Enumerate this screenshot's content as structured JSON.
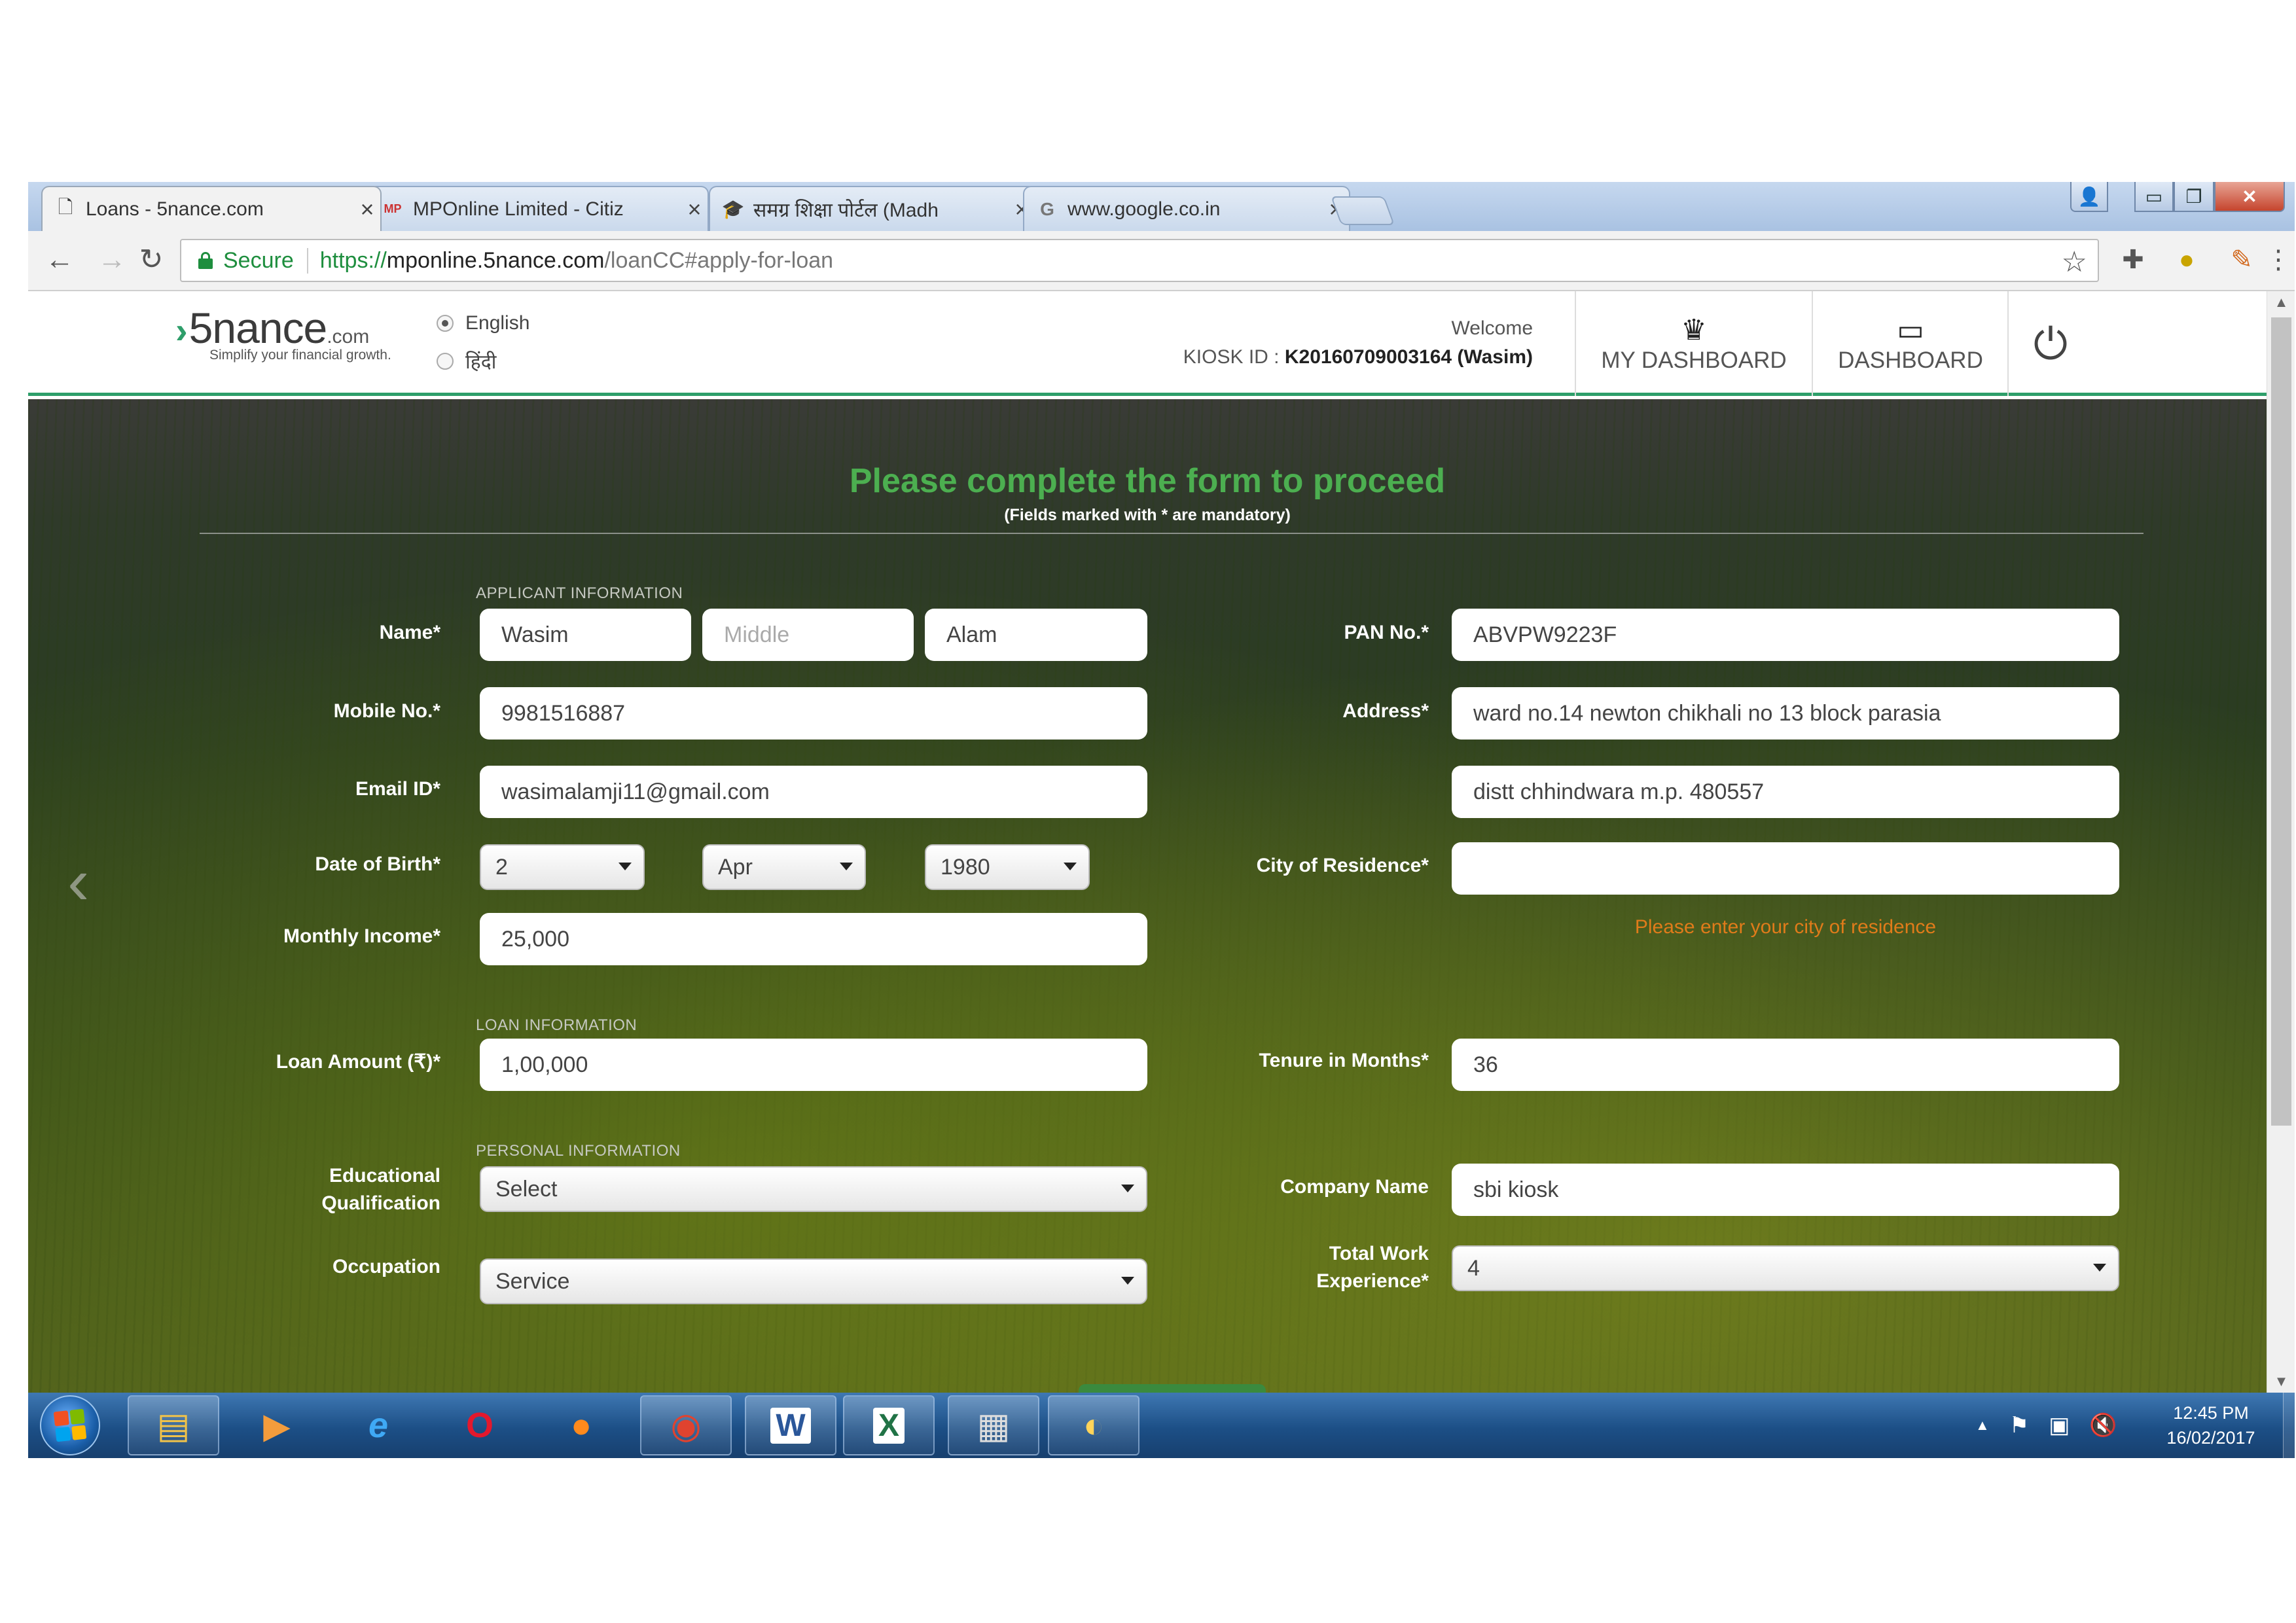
{
  "browser": {
    "tabs": [
      {
        "label": "Loans - 5nance.com",
        "icon": "page-icon",
        "close": "×"
      },
      {
        "label": "MPOnline Limited - Citiz",
        "icon": "mponline-icon",
        "close": "×"
      },
      {
        "label": "समग्र शिक्षा पोर्टल (Madh",
        "icon": "graduation-cap-icon",
        "close": "×"
      },
      {
        "label": "www.google.co.in",
        "icon": "google-icon",
        "close": "×"
      }
    ],
    "secure_label": "Secure",
    "url_scheme": "https://",
    "url_host": "mponline.5nance.com",
    "url_path": "/loanCC#apply-for-loan"
  },
  "site": {
    "logo_name": "5nance",
    "logo_com": ".com",
    "logo_tagline": "Simplify your financial growth.",
    "languages": [
      "English",
      "हिंदी"
    ],
    "selected_language": "English",
    "welcome": "Welcome",
    "kiosk_label": "KIOSK ID : ",
    "kiosk_value": "K20160709003164 (Wasim)",
    "nav": [
      "MY DASHBOARD",
      "DASHBOARD"
    ]
  },
  "form": {
    "title": "Please complete the form to proceed",
    "subtitle": "(Fields marked with * are mandatory)",
    "sections": {
      "applicant": "APPLICANT INFORMATION",
      "loan": "LOAN INFORMATION",
      "personal": "PERSONAL INFORMATION"
    },
    "labels": {
      "name": "Name*",
      "mobile": "Mobile No.*",
      "email": "Email ID*",
      "dob": "Date of Birth*",
      "income": "Monthly Income*",
      "loan_amount": "Loan Amount (₹)*",
      "education_1": "Educational",
      "education_2": "Qualification",
      "occupation": "Occupation",
      "pan": "PAN No.*",
      "address": "Address*",
      "city": "City of Residence*",
      "tenure": "Tenure in Months*",
      "company": "Company Name",
      "experience_1": "Total Work",
      "experience_2": "Experience*"
    },
    "values": {
      "first_name": "Wasim",
      "middle_name_placeholder": "Middle",
      "last_name": "Alam",
      "mobile": "9981516887",
      "email": "wasimalamji11@gmail.com",
      "dob_day": "2",
      "dob_month": "Apr",
      "dob_year": "1980",
      "income": "25,000",
      "loan_amount": "1,00,000",
      "education": "Select",
      "occupation": "Service",
      "pan": "ABVPW9223F",
      "address_line1": "ward no.14 newton chikhali no 13 block parasia",
      "address_line2": "distt chhindwara m.p. 480557",
      "city": "",
      "tenure": "36",
      "company": "sbi kiosk",
      "experience": "4"
    },
    "city_error": "Please enter your city of residence"
  },
  "taskbar": {
    "time": "12:45 PM",
    "date": "16/02/2017"
  }
}
